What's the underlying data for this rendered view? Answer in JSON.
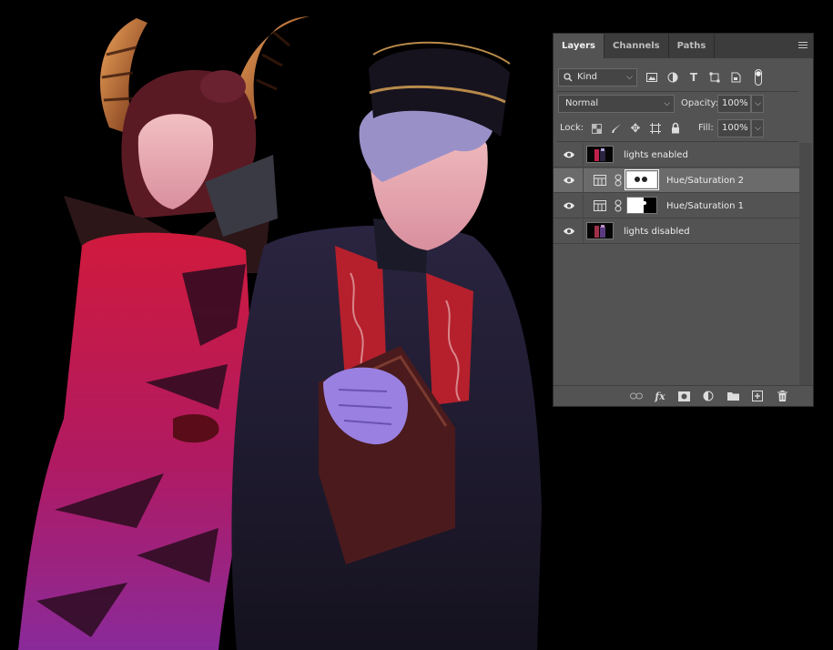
{
  "panel": {
    "tabs": [
      {
        "label": "Layers",
        "active": true
      },
      {
        "label": "Channels",
        "active": false
      },
      {
        "label": "Paths",
        "active": false
      }
    ],
    "filter": {
      "kind_label": "Kind",
      "icons": [
        "image-filter-icon",
        "adjustment-filter-icon",
        "type-filter-icon",
        "shape-filter-icon",
        "smart-object-filter-icon",
        "filter-toggle-icon"
      ]
    },
    "blend_mode": "Normal",
    "opacity_label": "Opacity:",
    "opacity_value": "100%",
    "lock_label": "Lock:",
    "fill_label": "Fill:",
    "fill_value": "100%",
    "layers": [
      {
        "name": "lights enabled",
        "type": "pixel",
        "selected": false
      },
      {
        "name": "Hue/Saturation 2",
        "type": "adjustment",
        "selected": true
      },
      {
        "name": "Hue/Saturation 1",
        "type": "adjustment",
        "selected": false
      },
      {
        "name": "lights disabled",
        "type": "pixel",
        "selected": false
      }
    ],
    "footer_icons": [
      "link-layers-icon",
      "fx-icon",
      "add-mask-icon",
      "new-adjustment-icon",
      "new-group-icon",
      "new-layer-icon",
      "delete-layer-icon"
    ],
    "fx_label": "fx"
  },
  "colors": {
    "panel_bg": "#535353",
    "tab_bar": "#3c3c3c",
    "selected_row": "#6b6b6b",
    "canvas_bg": "#000000"
  }
}
